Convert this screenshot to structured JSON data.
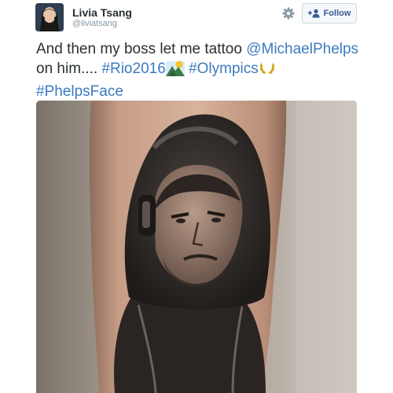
{
  "user": {
    "display_name": "Livia Tsang",
    "handle": "@liviatsang"
  },
  "actions": {
    "follow_label": "Follow"
  },
  "tweet": {
    "text_plain": "And then my boss let me tattoo ",
    "mention": "@MichaelPhelps",
    "text_after_mention": " on him.... ",
    "hashtag_1": "#Rio2016",
    "hashtag_2": "#Olympics",
    "hashtag_3": "#PhelpsFace"
  },
  "icons": {
    "gear": "gear-icon",
    "follow": "add-person-icon",
    "emoji_1": "national-park-emoji-icon",
    "emoji_2": "laurel-wreath-emoji-icon"
  },
  "colors": {
    "link": "#3b7bbf",
    "text": "#292f33",
    "muted": "#8899a6",
    "follow_text": "#3b5998"
  }
}
